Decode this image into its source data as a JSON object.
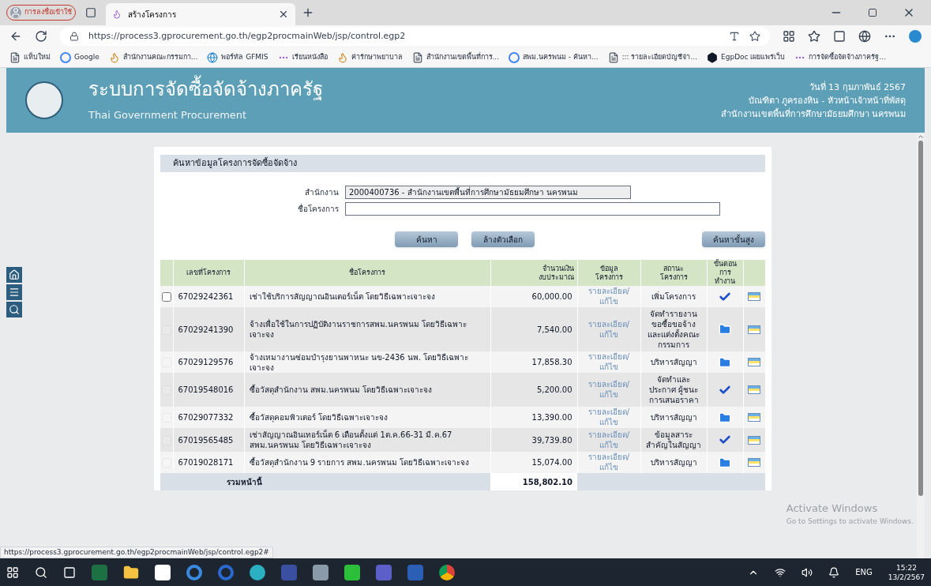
{
  "browser": {
    "profile_button": "การลงชื่อเข้าใช้",
    "tabs": [
      {
        "label": "สร้างโครงการ",
        "selected": true
      }
    ],
    "address": "https://process3.gprocurement.go.th/egp2procmainWeb/jsp/control.egp2",
    "bookmarks": [
      {
        "label": "แท็บใหม่",
        "kind": "page"
      },
      {
        "label": "Google",
        "kind": "google"
      },
      {
        "label": "สำนักงานคณะกรรมกา...",
        "kind": "flame"
      },
      {
        "label": "พอร์ทัล GFMIS",
        "kind": "globe"
      },
      {
        "label": "เรียนหนังสือ",
        "kind": "dots"
      },
      {
        "label": "ค่ารักษาพยาบาล",
        "kind": "flame"
      },
      {
        "label": "สำนักงานเขตพื้นที่การ...",
        "kind": "page"
      },
      {
        "label": "สพม.นครพนม - ค้นหา...",
        "kind": "google"
      },
      {
        "label": "::: รายละเอียดบัญชีจ่า...",
        "kind": "page"
      },
      {
        "label": "EgpDoc เผยแพร่เว็บ",
        "kind": "hex"
      },
      {
        "label": "การจัดซื้อจัดจ้างภาครัฐ...",
        "kind": "dots"
      }
    ]
  },
  "header": {
    "title": "ระบบการจัดซื้อจัดจ้างภาครัฐ",
    "subtitle": "Thai Government Procurement",
    "date": "วันที่ 13 กุมภาพันธ์ 2567",
    "user": "บัณฑิตา ภูครองหิน - หัวหน้าเจ้าหน้าที่พัสดุ",
    "office": "สำนักงานเขตพื้นที่การศึกษามัธยมศึกษา นครพนม"
  },
  "search": {
    "title": "ค้นหาข้อมูลโครงการจัดซื้อจัดจ้าง",
    "fields": [
      {
        "label": "สำนักงาน",
        "value": "2000400736 - สำนักงานเขตพื้นที่การศึกษามัธยมศึกษา นครพนม",
        "disabled": true
      },
      {
        "label": "ชื่อโครงการ",
        "disabled": false
      }
    ],
    "buttons": [
      "ค้นหา",
      "ล้างตัวเลือก"
    ],
    "advanced_button": "ค้นหาขั้นสูง"
  },
  "table": {
    "columns": [
      "เลขที่โครงการ",
      "ชื่อโครงการ",
      "จำนวนเงิน\nงบประมาณ",
      "ข้อมูล\nโครงการ",
      "สถานะ\nโครงการ",
      "ขั้นตอน\nการทำงาน"
    ],
    "rows": [
      {
        "number": "67029242361",
        "name": "เช่าใช้บริการสัญญาณอินเตอร์เน็ต โดยวิธีเฉพาะเจาะจง",
        "amount": "60,000.00",
        "link": "รายละเอียด/\nแก้ไข",
        "status": "เพิ่มโครงการ",
        "kind": "check",
        "disabled": false
      },
      {
        "number": "67029241390",
        "name": "จ้างเพื่อใช้ในการปฏิบัติงานราชการสพม.นครพนม โดยวิธีเฉพาะเจาะจง",
        "amount": "7,540.00",
        "link": "รายละเอียด/\nแก้ไข",
        "status": "จัดทำรายงานขอซื้อขอจ้างและแต่งตั้งคณะกรรมการ",
        "kind": "doc",
        "disabled": true
      },
      {
        "number": "67029129576",
        "name": "จ้างเหมางานซ่อมบำรุงยานพาหนะ นข-2436 นพ. โดยวิธีเฉพาะเจาะจง",
        "amount": "17,858.30",
        "link": "รายละเอียด/\nแก้ไข",
        "status": "บริหารสัญญา",
        "kind": "doc",
        "disabled": true
      },
      {
        "number": "67019548016",
        "name": "ซื้อวัสดุสำนักงาน สพม.นครพนม โดยวิธีเฉพาะเจาะจง",
        "amount": "5,200.00",
        "link": "รายละเอียด/\nแก้ไข",
        "status": "จัดทำและประกาศ ผู้ชนะการเสนอราคา",
        "kind": "check",
        "disabled": true
      },
      {
        "number": "67029077332",
        "name": "ซื้อวัสดุคอมพิวเตอร์ โดยวิธีเฉพาะเจาะจง",
        "amount": "13,390.00",
        "link": "รายละเอียด/\nแก้ไข",
        "status": "บริหารสัญญา",
        "kind": "doc",
        "disabled": true
      },
      {
        "number": "67019565485",
        "name": "เช่าสัญญาณอินเทอร์เน็ต 6 เดือนตั้งแต่ 1ต.ค.66-31 มี.ค.67 สพม.นครพนม โดยวิธีเฉพาะเจาะจง",
        "amount": "39,739.80",
        "link": "รายละเอียด/\nแก้ไข",
        "status": "ข้อมูลสาระสำคัญในสัญญา",
        "kind": "check",
        "disabled": true
      },
      {
        "number": "67019028171",
        "name": "ซื้อวัสดุสำนักงาน 9 รายการ สพม.นครพนม โดยวิธีเฉพาะเจาะจง",
        "amount": "15,074.00",
        "link": "รายละเอียด/\nแก้ไข",
        "status": "บริหารสัญญา",
        "kind": "doc",
        "disabled": true
      }
    ],
    "total_label": "รวมหน้านี้",
    "total": "158,802.10"
  },
  "status_url": "https://process3.gprocurement.go.th/egp2procmainWeb/jsp/control.egp2#",
  "activation": {
    "title": "Activate Windows",
    "hint": "Go to Settings to activate Windows."
  },
  "taskbar": {
    "language": "ENG",
    "time": "15:22",
    "date": "13/2/2567"
  }
}
